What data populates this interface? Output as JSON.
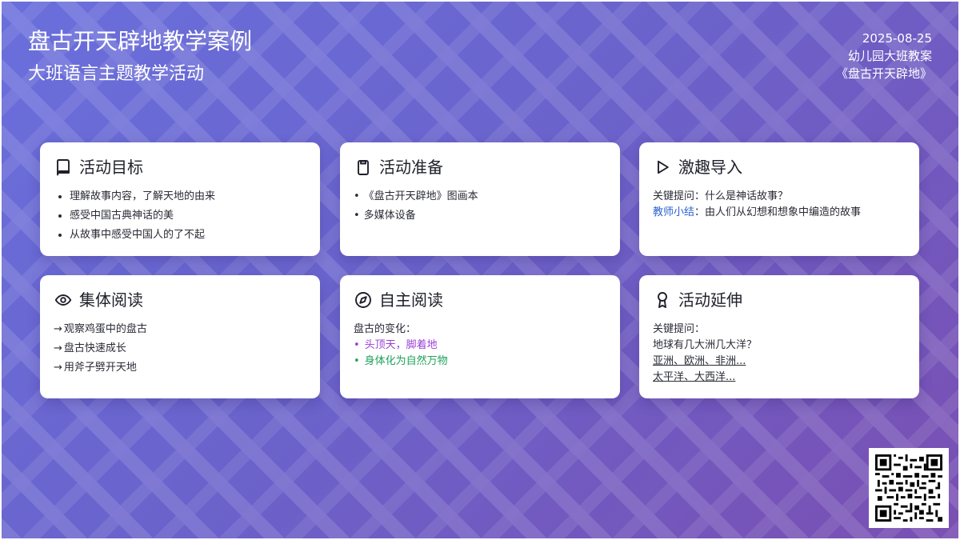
{
  "header": {
    "title": "盘古开天辟地教学案例",
    "subtitle": "大班语言主题教学活动",
    "date": "2025-08-25",
    "class": "幼儿园大班教案",
    "book": "《盘古开天辟地》"
  },
  "cards": [
    {
      "title": "活动目标",
      "icon": "book-icon",
      "items": [
        "理解故事内容，了解天地的由来",
        "感受中国古典神话的美",
        "从故事中感受中国人的了不起"
      ]
    },
    {
      "title": "活动准备",
      "icon": "clipboard-icon",
      "items": [
        "《盘古开天辟地》图画本",
        "多媒体设备"
      ]
    },
    {
      "title": "激趣导入",
      "icon": "play-icon",
      "question": "关键提问：什么是神话故事？",
      "summary_label": "教师小结",
      "summary_text": "：由人们从幻想和想象中编造的故事"
    },
    {
      "title": "集体阅读",
      "icon": "eye-icon",
      "items": [
        "观察鸡蛋中的盘古",
        "盘古快速成长",
        "用斧子劈开天地"
      ]
    },
    {
      "title": "自主阅读",
      "icon": "compass-icon",
      "intro": "盘古的变化：",
      "items": [
        "头顶天，脚着地",
        "身体化为自然万物"
      ]
    },
    {
      "title": "活动延伸",
      "icon": "award-icon",
      "question_label": "关键提问：",
      "question": "地球有几大洲几大洋？",
      "link1": "亚洲、欧洲、非洲...",
      "link2": "太平洋、大西洋..."
    }
  ],
  "colors": {
    "accent": "#2b5fd3",
    "purple": "#9a3fd6",
    "green": "#1fa05a"
  },
  "qr": {
    "icon": "qr-code-icon"
  }
}
